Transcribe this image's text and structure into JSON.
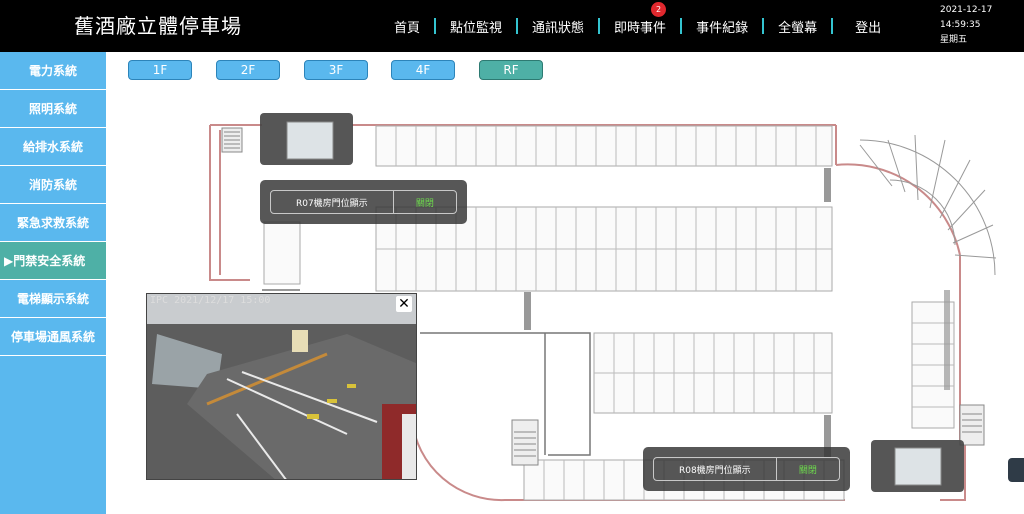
{
  "header": {
    "title": "舊酒廠立體停車場",
    "nav": [
      {
        "label": "首頁"
      },
      {
        "label": "點位監視"
      },
      {
        "label": "通訊狀態"
      },
      {
        "label": "即時事件",
        "badge": "2"
      },
      {
        "label": "事件紀錄"
      },
      {
        "label": "全螢幕"
      },
      {
        "label": "登出"
      }
    ],
    "date": "2021-12-17",
    "time": "14:59:35",
    "weekday": "星期五"
  },
  "sidebar": {
    "items": [
      {
        "label": "電力系統"
      },
      {
        "label": "照明系統"
      },
      {
        "label": "給排水系統"
      },
      {
        "label": "消防系統"
      },
      {
        "label": "緊急求救系統"
      },
      {
        "label": "▶門禁安全系統",
        "active": true
      },
      {
        "label": "電梯顯示系統"
      },
      {
        "label": "停車場通風系統"
      }
    ]
  },
  "floors": [
    {
      "label": "1F"
    },
    {
      "label": "2F"
    },
    {
      "label": "3F"
    },
    {
      "label": "4F"
    },
    {
      "label": "RF",
      "active": true
    }
  ],
  "popups": {
    "r07": {
      "label": "R07機房門位顯示",
      "status": "關閉"
    },
    "r08": {
      "label": "R08機房門位顯示",
      "status": "關閉"
    }
  },
  "camera": {
    "overlay_text": "IPC   2021/12/17  15:00",
    "close_label": "✕"
  },
  "colors": {
    "header_bg": "#000000",
    "sidebar_bg": "#5ab8ee",
    "active_bg": "#4eb0a6",
    "wall": "#c98a8a",
    "status_green": "#6ddc4c",
    "badge": "#e0282e"
  }
}
